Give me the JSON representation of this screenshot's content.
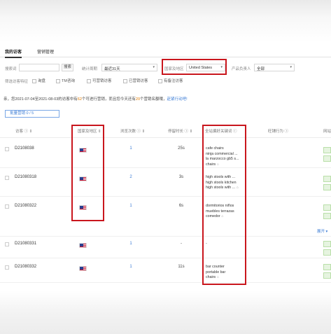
{
  "tabs": [
    {
      "label": "我的访客",
      "active": true
    },
    {
      "label": "营销管理",
      "active": false
    }
  ],
  "filters": {
    "search_label": "搜索词",
    "search_value": "",
    "search_button": "搜索",
    "period_label": "统计周期",
    "period_value": "最近31天",
    "region_label": "国家及地区",
    "region_value": "United States",
    "owner_label": "产品负责人",
    "owner_value": "全部",
    "prefs_label": "筛选访客特征",
    "checkboxes": [
      "询盘",
      "TM咨询",
      "可营销访客",
      "已营销访客",
      "有备注访客"
    ]
  },
  "notice": {
    "pre": "亲，您2021-07-04至2021-08-03的访客中有",
    "count1": "62",
    "mid": "个可进行营销，而且您今天还有",
    "count2": "20",
    "post": "个营销名额哦，",
    "link": "赶紧行动吧!"
  },
  "batch_button": "批量营销  0 / 5",
  "table": {
    "headers": {
      "visitor": "访客",
      "region": "国家及地区",
      "views": "浏览次数",
      "duration": "停留时长",
      "keywords": "全站偏好关键词",
      "behavior": "旺铺行为",
      "last": "网站"
    },
    "rows": [
      {
        "id": "D2108038",
        "views": "1",
        "duration": "25s",
        "keywords": [
          "cafe chairs",
          "ninja commercial ...",
          "la marzocco gb5 s...",
          "chairs"
        ]
      },
      {
        "id": "D21080318",
        "views": "2",
        "duration": "3s",
        "keywords": [
          "high stools with ...",
          "high stools kitchen",
          "high stools with ..."
        ]
      },
      {
        "id": "D21080322",
        "views": "1",
        "duration": "6s",
        "keywords": [
          "dormitorios niños",
          "muebles terrazas",
          "comedor"
        ]
      },
      {
        "id": "D21080331",
        "views": "1",
        "duration": "-",
        "keywords": [
          "-"
        ]
      },
      {
        "id": "D21080332",
        "views": "1",
        "duration": "11s",
        "keywords": [
          "bar counter",
          "portable bar",
          "chairs"
        ]
      }
    ]
  },
  "more_link": "展开",
  "colors": {
    "highlight_red": "#c9161d",
    "link_blue": "#3a7bd5",
    "notice_orange": "#e07b00"
  }
}
